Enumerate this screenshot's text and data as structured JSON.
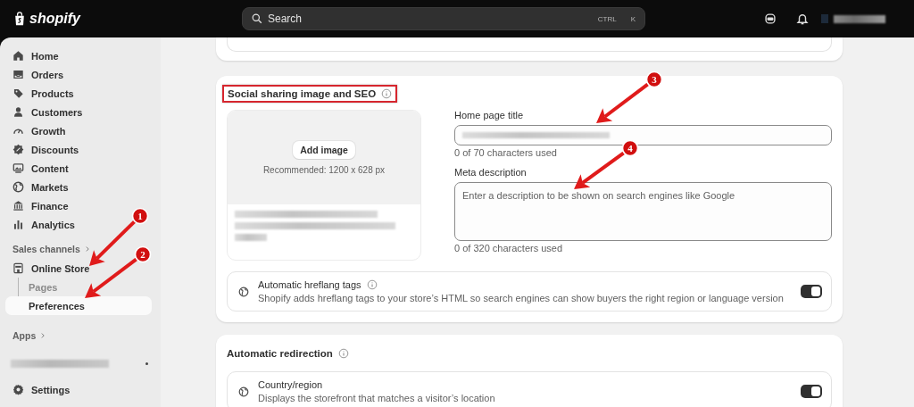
{
  "topbar": {
    "logo": "shopify",
    "search": {
      "placeholder": "Search",
      "keys": [
        "CTRL",
        "K"
      ]
    }
  },
  "sidebar": {
    "items": [
      {
        "label": "Home",
        "kind": "home",
        "selected": false
      },
      {
        "label": "Orders",
        "kind": "tray",
        "selected": false
      },
      {
        "label": "Products",
        "kind": "tag",
        "selected": false
      },
      {
        "label": "Customers",
        "kind": "person",
        "selected": false
      },
      {
        "label": "Growth",
        "kind": "gauge",
        "selected": false
      },
      {
        "label": "Discounts",
        "kind": "badge",
        "selected": false
      },
      {
        "label": "Content",
        "kind": "monitor",
        "selected": false
      },
      {
        "label": "Markets",
        "kind": "globe",
        "selected": false
      },
      {
        "label": "Finance",
        "kind": "bank",
        "selected": false
      },
      {
        "label": "Analytics",
        "kind": "chart",
        "selected": false
      }
    ],
    "sales_channels": {
      "label": "Sales channels",
      "channels": [
        {
          "label": "Online Store",
          "kind": "store",
          "selected": false,
          "children": [
            {
              "label": "Pages",
              "selected": false
            },
            {
              "label": "Preferences",
              "selected": true
            }
          ]
        }
      ]
    },
    "apps": {
      "label": "Apps"
    },
    "footer": [
      {
        "label": "Settings",
        "kind": "settings",
        "selected": false
      }
    ]
  },
  "seo": {
    "title": "Social sharing image and SEO",
    "highlighted": true,
    "image": {
      "button": "Add image",
      "hint": "Recommended: 1200 x 628 px"
    },
    "home_title": {
      "label": "Home page title",
      "counter": "0 of 70 characters used"
    },
    "meta": {
      "label": "Meta description",
      "placeholder": "Enter a description to be shown on search engines like Google",
      "counter": "0 of 320 characters used"
    },
    "settings": [
      {
        "title": "Automatic hreflang tags",
        "info": true,
        "description": "Shopify adds hreflang tags to your store’s HTML so search engines can show buyers the right region or language version",
        "on": true
      }
    ]
  },
  "redirection": {
    "title": "Automatic redirection",
    "settings": [
      {
        "title": "Country/region",
        "info": false,
        "description": "Displays the storefront that matches a visitor’s location",
        "on": true
      }
    ]
  },
  "annotations": [
    {
      "number": "1"
    },
    {
      "number": "2"
    },
    {
      "number": "3"
    },
    {
      "number": "4"
    }
  ]
}
